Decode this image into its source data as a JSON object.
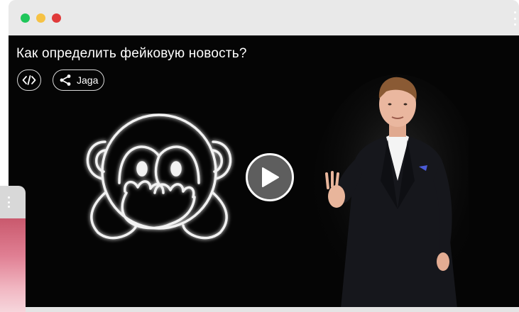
{
  "window": {
    "traffic_lights": [
      {
        "name": "green",
        "color": "#1fc65a"
      },
      {
        "name": "yellow",
        "color": "#f6c244"
      },
      {
        "name": "red",
        "color": "#e03a3a"
      }
    ],
    "menu_icon": "kebab-vertical-icon"
  },
  "video": {
    "title": "Как определить фейковую новость?",
    "embed_icon": "code-embed-icon",
    "share": {
      "icon": "share-icon",
      "label": "Jaga"
    },
    "play_icon": "play-icon",
    "artwork_icon": "see-no-evil-monkey-icon"
  },
  "side_card": {
    "menu_icon": "kebab-vertical-icon"
  }
}
